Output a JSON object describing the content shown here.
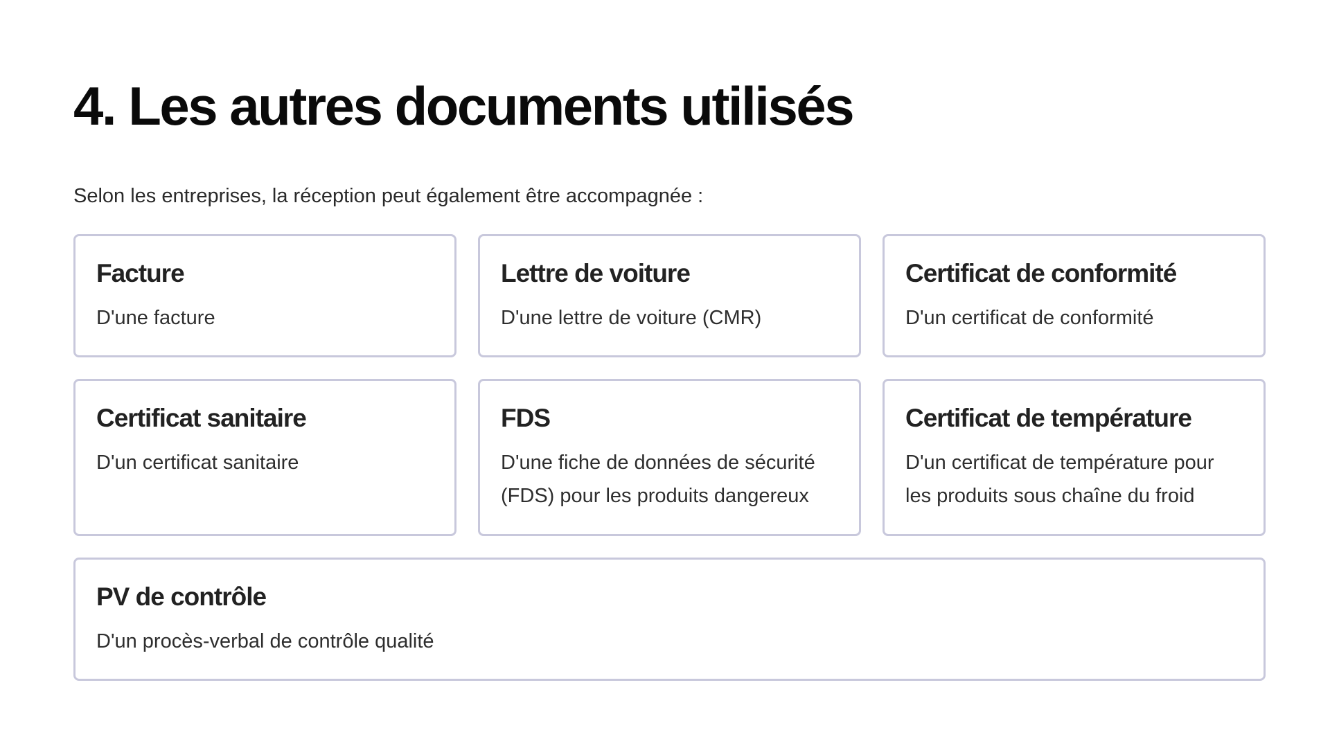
{
  "slide": {
    "title": "4. Les autres documents utilisés",
    "intro": "Selon les entreprises, la réception peut également être accompagnée :",
    "cards": [
      {
        "title": "Facture",
        "description": "D'une facture"
      },
      {
        "title": "Lettre de voiture",
        "description": "D'une lettre de voiture (CMR)"
      },
      {
        "title": "Certificat de conformité",
        "description": "D'un certificat de conformité"
      },
      {
        "title": "Certificat sanitaire",
        "description": "D'un certificat sanitaire"
      },
      {
        "title": "FDS",
        "description": "D'une fiche de données de sécurité (FDS) pour les produits dangereux"
      },
      {
        "title": "Certificat de température",
        "description": "D'un certificat de température pour les produits sous chaîne du froid"
      },
      {
        "title": "PV de contrôle",
        "description": "D'un procès-verbal de contrôle qualité"
      }
    ],
    "colors": {
      "title": "#0a0a0a",
      "text": "#222222",
      "card_border": "#c8c8dc",
      "background": "#ffffff"
    }
  }
}
